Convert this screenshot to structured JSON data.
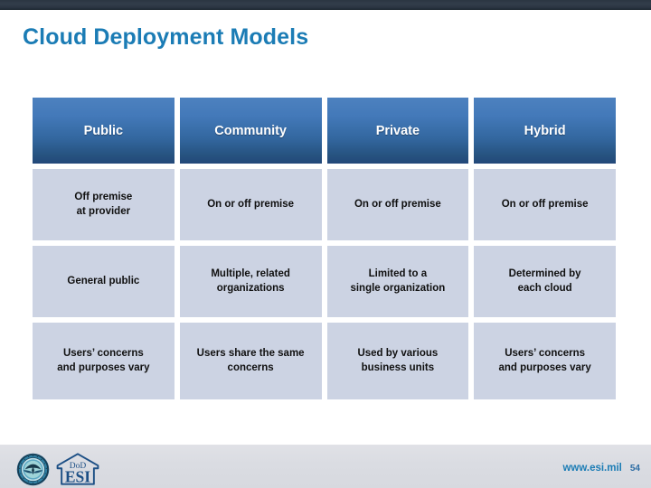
{
  "slide": {
    "title": "Cloud Deployment Models",
    "title_color": "#1b7cb5",
    "accent_header_color": "#33679f",
    "cell_background_color": "#ccd3e3"
  },
  "table": {
    "headers": [
      "Public",
      "Community",
      "Private",
      "Hybrid"
    ],
    "rows": [
      [
        "Off premise\nat provider",
        "On or off premise",
        "On or off premise",
        "On or off premise"
      ],
      [
        "General public",
        "Multiple, related\norganizations",
        "Limited to a\nsingle organization",
        "Determined by\neach cloud"
      ],
      [
        "Users’ concerns\nand purposes vary",
        "Users share the same\nconcerns",
        "Used by various\nbusiness units",
        "Users’ concerns\nand purposes vary"
      ]
    ]
  },
  "footer": {
    "dod_seal_alt": "dod-seal",
    "esi_logo_top_text": "DoD",
    "esi_logo_main_text": "ESI",
    "site_url": "www.esi.mil",
    "page_number": "54"
  }
}
